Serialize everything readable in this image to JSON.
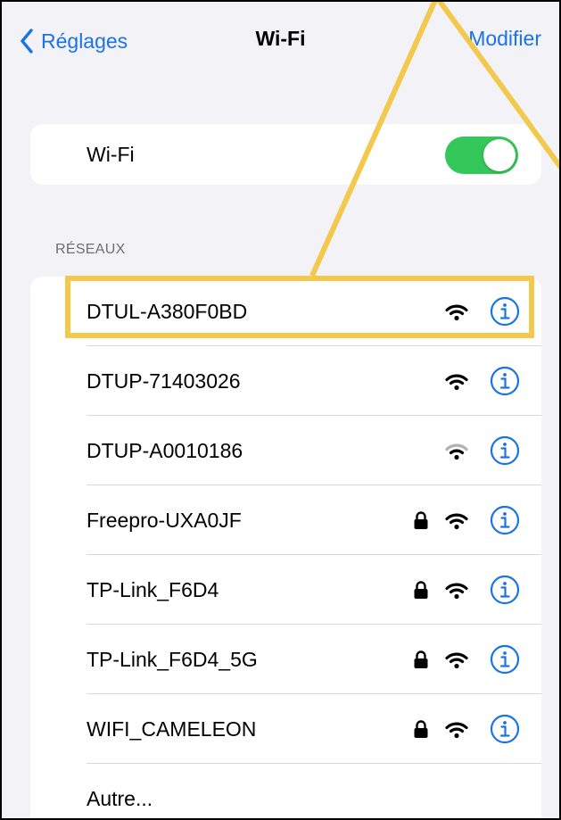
{
  "nav": {
    "back_label": "Réglages",
    "title": "Wi-Fi",
    "edit_label": "Modifier"
  },
  "wifi_toggle": {
    "label": "Wi-Fi",
    "on": true
  },
  "networks_section": {
    "header": "RÉSEAUX",
    "items": [
      {
        "name": "DTUL-A380F0BD",
        "secured": false,
        "signal": "strong"
      },
      {
        "name": "DTUP-71403026",
        "secured": false,
        "signal": "strong"
      },
      {
        "name": "DTUP-A0010186",
        "secured": false,
        "signal": "weak"
      },
      {
        "name": "Freepro-UXA0JF",
        "secured": true,
        "signal": "strong"
      },
      {
        "name": "TP-Link_F6D4",
        "secured": true,
        "signal": "strong"
      },
      {
        "name": "TP-Link_F6D4_5G",
        "secured": true,
        "signal": "strong"
      },
      {
        "name": "WIFI_CAMELEON",
        "secured": true,
        "signal": "strong"
      }
    ],
    "other_label": "Autre..."
  },
  "icons": {
    "back": "chevron-left-icon",
    "lock": "lock-icon",
    "wifi": "wifi-signal-icon",
    "info": "info-icon"
  },
  "colors": {
    "accent": "#1a73e8",
    "toggle_on": "#34c759",
    "highlight": "#f2c94c",
    "background": "#f2f2f7",
    "weak_signal": "#b0b0b5"
  }
}
